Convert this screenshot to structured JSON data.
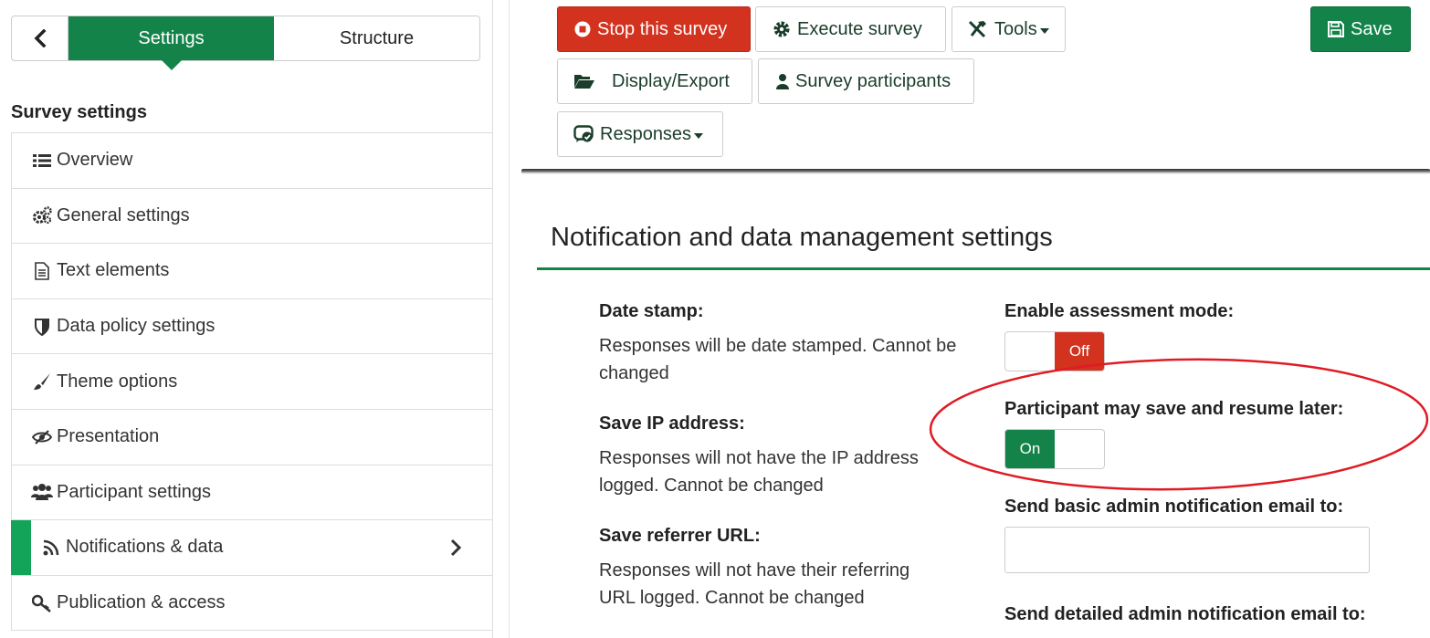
{
  "sidebar": {
    "tabs": {
      "settings": "Settings",
      "structure": "Structure"
    },
    "heading": "Survey settings",
    "items": [
      {
        "label": "Overview",
        "icon": "list-icon"
      },
      {
        "label": "General settings",
        "icon": "gears-icon"
      },
      {
        "label": "Text elements",
        "icon": "file-text-icon"
      },
      {
        "label": "Data policy settings",
        "icon": "shield-icon"
      },
      {
        "label": "Theme options",
        "icon": "paintbrush-icon"
      },
      {
        "label": "Presentation",
        "icon": "eye-slash-icon"
      },
      {
        "label": "Participant settings",
        "icon": "users-icon"
      },
      {
        "label": "Notifications & data",
        "icon": "rss-icon",
        "active": true
      },
      {
        "label": "Publication & access",
        "icon": "key-icon"
      }
    ]
  },
  "toolbar": {
    "stop": "Stop this survey",
    "execute": "Execute survey",
    "tools": "Tools",
    "save": "Save",
    "display_export": "Display/Export",
    "participants": "Survey participants",
    "responses": "Responses"
  },
  "main": {
    "title": "Notification and data management settings",
    "date_stamp": {
      "label": "Date stamp:",
      "text": "Responses will be date stamped. Cannot be changed"
    },
    "save_ip": {
      "label": "Save IP address:",
      "text": "Responses will not have the IP address logged. Cannot be changed"
    },
    "save_referrer": {
      "label": "Save referrer URL:",
      "text": "Responses will not have their referring URL logged. Cannot be changed"
    },
    "assessment": {
      "label": "Enable assessment mode:",
      "value": "Off"
    },
    "save_resume": {
      "label": "Participant may save and resume later:",
      "value": "On"
    },
    "basic_email": {
      "label": "Send basic admin notification email to:",
      "value": ""
    },
    "detailed_email": {
      "label": "Send detailed admin notification email to:"
    }
  },
  "colors": {
    "brand_green": "#13834a",
    "active_bar": "#13a45a",
    "danger_red": "#d2321e",
    "annotation_red": "#e01b24"
  }
}
